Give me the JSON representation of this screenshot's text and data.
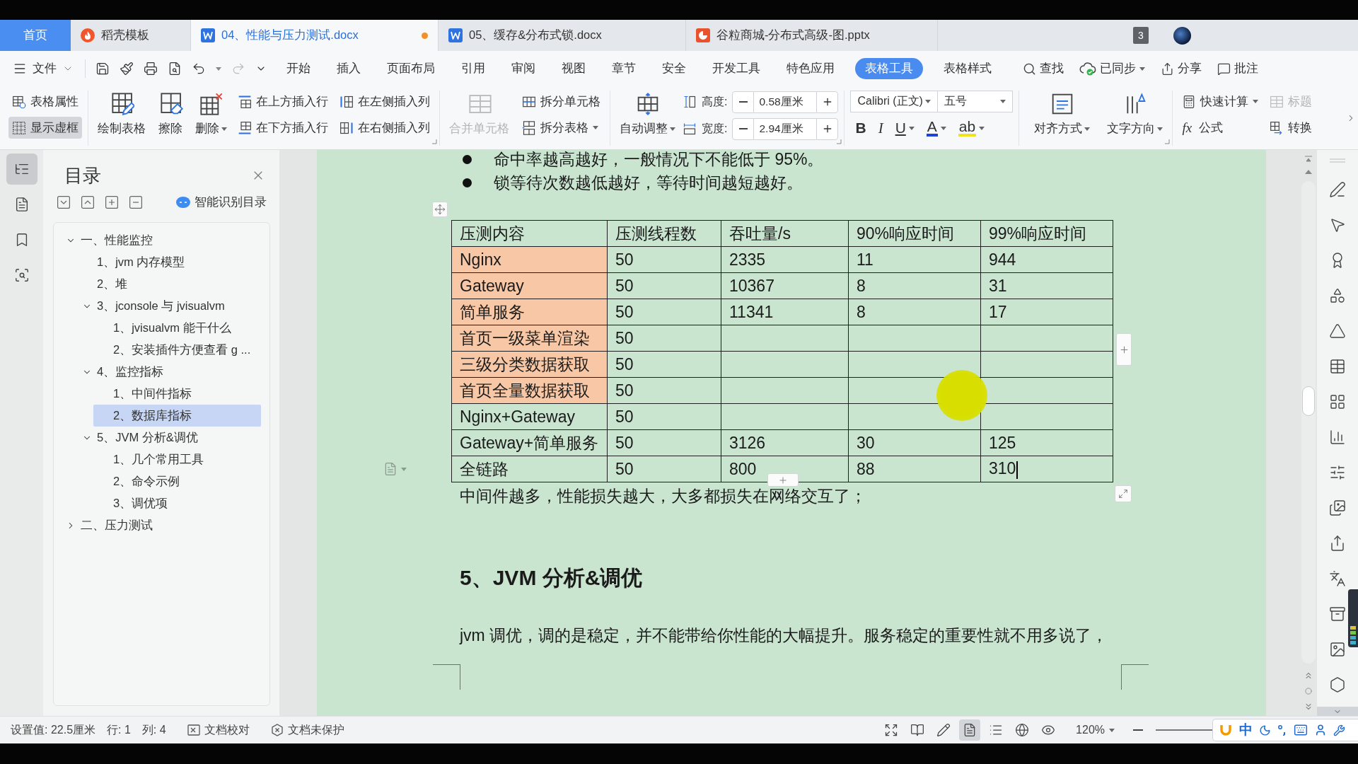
{
  "tab_bar": {
    "tabs": [
      {
        "kind": "home",
        "label": "首页",
        "selected": false,
        "unsaved": false
      },
      {
        "kind": "template",
        "label": "稻壳模板",
        "selected": false,
        "unsaved": false
      },
      {
        "kind": "writer",
        "label": "04、性能与压力测试.docx",
        "selected": true,
        "unsaved": true
      },
      {
        "kind": "writer",
        "label": "05、缓存&分布式锁.docx",
        "selected": false,
        "unsaved": false
      },
      {
        "kind": "presentation",
        "label": "谷粒商城-分布式高级-图.pptx",
        "selected": false,
        "unsaved": false
      }
    ],
    "window_count": "3"
  },
  "menu_bar": {
    "file": "文件",
    "tabs": [
      {
        "label": "开始",
        "selected": false
      },
      {
        "label": "插入",
        "selected": false
      },
      {
        "label": "页面布局",
        "selected": false
      },
      {
        "label": "引用",
        "selected": false
      },
      {
        "label": "审阅",
        "selected": false
      },
      {
        "label": "视图",
        "selected": false
      },
      {
        "label": "章节",
        "selected": false
      },
      {
        "label": "安全",
        "selected": false
      },
      {
        "label": "开发工具",
        "selected": false
      },
      {
        "label": "特色应用",
        "selected": false
      },
      {
        "label": "表格工具",
        "selected": true
      },
      {
        "label": "表格样式",
        "selected": false
      }
    ],
    "actions": [
      {
        "kind": "search",
        "label": "查找",
        "dropdown": false
      },
      {
        "kind": "sync",
        "label": "已同步",
        "dropdown": true
      },
      {
        "kind": "share",
        "label": "分享",
        "dropdown": false
      },
      {
        "kind": "comment",
        "label": "批注",
        "dropdown": false
      }
    ]
  },
  "ribbon": {
    "view_group": [
      {
        "kind": "properties",
        "label": "表格属性",
        "selected": false
      },
      {
        "kind": "gridlines",
        "label": "显示虚框",
        "selected": true
      }
    ],
    "draw_group": [
      {
        "kind": "draw",
        "label": "绘制表格",
        "dropdown": false
      },
      {
        "kind": "erase",
        "label": "擦除",
        "dropdown": false
      },
      {
        "kind": "delete",
        "label": "删除",
        "dropdown": true
      }
    ],
    "insert_group": [
      {
        "kind": "row_above",
        "label": "在上方插入行"
      },
      {
        "kind": "col_left",
        "label": "在左侧插入列"
      },
      {
        "kind": "row_below",
        "label": "在下方插入行"
      },
      {
        "kind": "col_right",
        "label": "在右侧插入列"
      }
    ],
    "merge": {
      "label": "合并单元格",
      "disabled": true
    },
    "split_group": [
      {
        "kind": "split_cells",
        "label": "拆分单元格",
        "dropdown": false
      },
      {
        "kind": "split_table",
        "label": "拆分表格",
        "dropdown": true
      }
    ],
    "autofit": {
      "label": "自动调整",
      "dropdown": true
    },
    "size_fields": [
      {
        "kind": "height",
        "label": "高度:",
        "value": "0.58厘米"
      },
      {
        "kind": "width",
        "label": "宽度:",
        "value": "2.94厘米"
      }
    ],
    "font": {
      "family": "Calibri (正文)",
      "size": "五号"
    },
    "format_buttons": [
      {
        "kind": "bold",
        "label": "B",
        "dropdown": false
      },
      {
        "kind": "italic",
        "label": "I",
        "dropdown": false
      },
      {
        "kind": "underline",
        "label": "U",
        "dropdown": true
      },
      {
        "kind": "font_color",
        "label": "A",
        "dropdown": true
      },
      {
        "kind": "highlight",
        "label": "ab",
        "dropdown": true
      }
    ],
    "layout_buttons": [
      {
        "kind": "align",
        "label": "对齐方式",
        "dropdown": true
      },
      {
        "kind": "direction",
        "label": "文字方向",
        "dropdown": true
      }
    ],
    "calc_group": [
      {
        "kind": "quick_calc",
        "label": "快速计算",
        "dropdown": true,
        "disabled": false
      },
      {
        "kind": "repeat_header",
        "label": "标题",
        "dropdown": false,
        "disabled": true
      },
      {
        "kind": "formula",
        "label": "公式",
        "symbol": "fx",
        "dropdown": false,
        "disabled": false
      },
      {
        "kind": "convert",
        "label": "转换",
        "dropdown": false,
        "disabled": false
      }
    ]
  },
  "nav_rail": [
    {
      "kind": "outline",
      "selected": true
    },
    {
      "kind": "pages",
      "selected": false
    },
    {
      "kind": "bookmarks",
      "selected": false
    },
    {
      "kind": "find",
      "selected": false
    }
  ],
  "outline_panel": {
    "title": "目录",
    "smart_button": "智能识别目录",
    "tree": [
      {
        "label": "一、性能监控",
        "selected": false,
        "expanded": true,
        "children": [
          {
            "label": "1、jvm 内存模型",
            "selected": false
          },
          {
            "label": "2、堆",
            "selected": false
          },
          {
            "label": "3、jconsole 与 jvisualvm",
            "selected": false,
            "expanded": true,
            "children": [
              {
                "label": "1、jvisualvm 能干什么",
                "selected": false
              },
              {
                "label": "2、安装插件方便查看 g ...",
                "selected": false
              }
            ]
          },
          {
            "label": "4、监控指标",
            "selected": false,
            "expanded": true,
            "children": [
              {
                "label": "1、中间件指标",
                "selected": false
              },
              {
                "label": "2、数据库指标",
                "selected": true
              }
            ]
          },
          {
            "label": "5、JVM 分析&调优",
            "selected": false,
            "expanded": true,
            "children": [
              {
                "label": "1、几个常用工具",
                "selected": false
              },
              {
                "label": "2、命令示例",
                "selected": false
              },
              {
                "label": "3、调优项",
                "selected": false
              }
            ]
          }
        ]
      },
      {
        "label": "二、压力测试",
        "selected": false,
        "expanded": false
      }
    ]
  },
  "document": {
    "bullets": [
      "命中率越高越好，一般情况下不能低于 95%。",
      "锁等待次数越低越好，等待时间越短越好。"
    ],
    "table": {
      "columns": [
        "压测内容",
        "压测线程数",
        "吞吐量/s",
        "90%响应时间",
        "99%响应时间"
      ],
      "rows": [
        {
          "cells": [
            "Nginx",
            "50",
            "2335",
            "11",
            "944"
          ],
          "shaded": true,
          "caret": false
        },
        {
          "cells": [
            "Gateway",
            "50",
            "10367",
            "8",
            "31"
          ],
          "shaded": true,
          "caret": false
        },
        {
          "cells": [
            "简单服务",
            "50",
            "11341",
            "8",
            "17"
          ],
          "shaded": true,
          "caret": false
        },
        {
          "cells": [
            "首页一级菜单渲染",
            "50",
            null,
            null,
            null
          ],
          "shaded": true,
          "caret": false
        },
        {
          "cells": [
            "三级分类数据获取",
            "50",
            null,
            null,
            null
          ],
          "shaded": true,
          "caret": false
        },
        {
          "cells": [
            "首页全量数据获取",
            "50",
            null,
            null,
            null
          ],
          "shaded": true,
          "caret": false
        },
        {
          "cells": [
            "Nginx+Gateway",
            "50",
            null,
            null,
            null
          ],
          "shaded": false,
          "caret": false
        },
        {
          "cells": [
            "Gateway+简单服务",
            "50",
            "3126",
            "30",
            "125"
          ],
          "shaded": false,
          "caret": false
        },
        {
          "cells": [
            "全链路",
            "50",
            "800",
            "88",
            "310"
          ],
          "shaded": false,
          "caret": true
        }
      ]
    },
    "note": "中间件越多，性能损失越大，大多都损失在网络交互了；",
    "heading": "5、JVM 分析&调优",
    "paragraph": "jvm 调优，调的是稳定，并不能带给你性能的大幅提升。服务稳定的重要性就不用多说了，"
  },
  "status_bar": {
    "fields": [
      {
        "kind": "text",
        "label": "设置值: 22.5厘米"
      },
      {
        "kind": "text",
        "label": "行: 1"
      },
      {
        "kind": "text",
        "label": "列: 4"
      },
      {
        "kind": "proofread",
        "label": "文档校对"
      },
      {
        "kind": "protection",
        "label": "文档未保护"
      }
    ],
    "views": [
      {
        "kind": "fullscreen",
        "selected": false
      },
      {
        "kind": "reading",
        "selected": false
      },
      {
        "kind": "writing",
        "selected": false
      },
      {
        "kind": "page",
        "selected": true
      },
      {
        "kind": "outline",
        "selected": false
      },
      {
        "kind": "web",
        "selected": false
      },
      {
        "kind": "eye_care",
        "selected": false
      }
    ],
    "zoom": "120%"
  },
  "ime_toolbar": {
    "mode": "中"
  }
}
